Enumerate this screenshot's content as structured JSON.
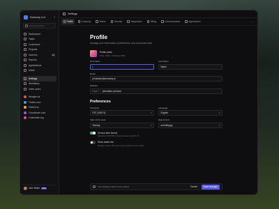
{
  "workspace": {
    "name": "Kentucky LLC"
  },
  "search": {
    "placeholder": "Search anything"
  },
  "nav": [
    {
      "label": "Dashboard",
      "icon": "grid-icon"
    },
    {
      "label": "Tasks",
      "icon": "check-icon"
    },
    {
      "label": "Customers",
      "icon": "users-icon"
    },
    {
      "label": "Projects",
      "icon": "folder-icon"
    },
    {
      "label": "Invoices",
      "icon": "file-icon",
      "badge": "16"
    },
    {
      "label": "Reports",
      "icon": "chart-icon"
    },
    {
      "label": "Applications",
      "icon": "apps-icon"
    },
    {
      "label": "Notes",
      "icon": "note-icon"
    }
  ],
  "nav2": [
    {
      "label": "Settings",
      "icon": "gear-icon",
      "active": true
    },
    {
      "label": "Workflows",
      "icon": "flow-icon"
    },
    {
      "label": "Invite users",
      "icon": "user-plus-icon"
    }
  ],
  "apps": [
    {
      "label": "Nextgen.ai",
      "color": "#e2574c"
    },
    {
      "label": "Tracks.com",
      "color": "#4b9cf5"
    },
    {
      "label": "Pathed.ai",
      "color": "#f5a623"
    },
    {
      "label": "Cloudchain.com",
      "color": "#8b5cf6"
    },
    {
      "label": "Codemate.org",
      "color": "#ec4899"
    }
  ],
  "user": {
    "name": "John Baker",
    "badge": "PRO"
  },
  "topbar": {
    "title": "Settings"
  },
  "tabs": [
    {
      "label": "Profile",
      "active": true
    },
    {
      "label": "Company"
    },
    {
      "label": "Teams"
    },
    {
      "label": "Security"
    },
    {
      "label": "Integrations"
    },
    {
      "label": "Billing"
    },
    {
      "label": "Communication"
    },
    {
      "label": "Appearance"
    }
  ],
  "profile": {
    "title": "Profile",
    "subtitle": "Manage your information, preferences, and connected data",
    "photo_title": "Profile photo",
    "photo_hint": "PNG, JPEG, 1:500 Max 5MB",
    "first_name_label": "First Name",
    "first_name_value": "|",
    "last_name_label": "Last Name",
    "last_name_value": "Baker",
    "email_label": "Email",
    "email_value": "johnbaker@kentucky.ai",
    "website_label": "Website",
    "website_prefix": "https://",
    "website_value": "johnbaker.co/home"
  },
  "preferences": {
    "title": "Preferences",
    "timezone_label": "Timezone",
    "timezone_value": "EST (GMT-5)",
    "language_label": "Language",
    "language_value": "English",
    "week_start_label": "Start of the week",
    "week_start_value": "Sunday",
    "date_format_label": "Date format",
    "date_format_value": "mm/dd/yyyy",
    "toggle1_title": "24-hour time format",
    "toggle1_desc": "Example: 00:00 PM. 24-hour format if switch off",
    "toggle1_on": true,
    "toggle2_title": "Show active dot",
    "toggle2_desc": "Display a green dot next to your avatar if you're online",
    "toggle2_on": false
  },
  "savebar": {
    "text": "Your changes haven't been saved",
    "cancel": "Cancel",
    "save": "Save changes"
  }
}
